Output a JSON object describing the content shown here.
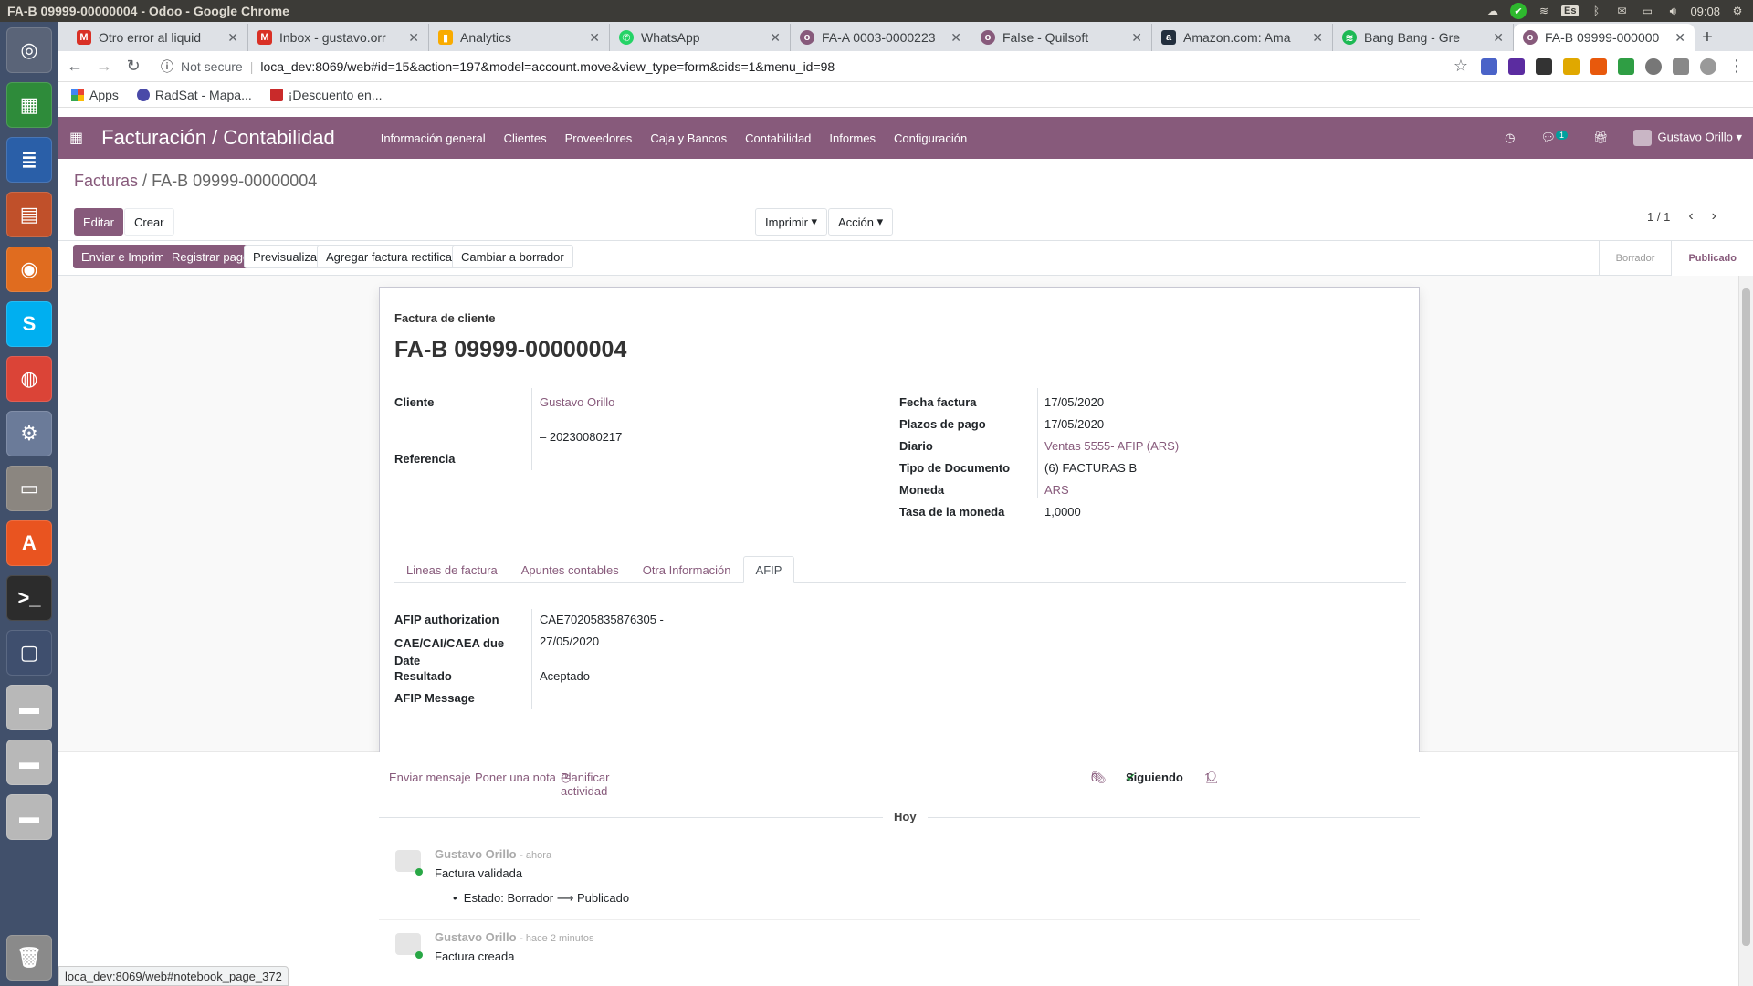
{
  "os": {
    "window_title": "FA-B 09999-00000004 - Odoo - Google Chrome",
    "clock": "09:08",
    "lang": "Es"
  },
  "chrome": {
    "tabs": [
      {
        "title": "Otro error al liquid",
        "favicon": "gmail-icon",
        "color": "#d93025"
      },
      {
        "title": "Inbox - gustavo.orr",
        "favicon": "gmail-icon",
        "color": "#d93025"
      },
      {
        "title": "Analytics",
        "favicon": "analytics-icon",
        "color": "#f9ab00"
      },
      {
        "title": "WhatsApp",
        "favicon": "whatsapp-icon",
        "color": "#25d366"
      },
      {
        "title": "FA-A 0003-0000223",
        "favicon": "odoo-icon",
        "color": "#875a7b"
      },
      {
        "title": "False - Quilsoft",
        "favicon": "odoo-icon",
        "color": "#875a7b"
      },
      {
        "title": "Amazon.com: Ama",
        "favicon": "amazon-icon",
        "color": "#232f3e"
      },
      {
        "title": "Bang Bang - Gre",
        "favicon": "spotify-icon",
        "color": "#1db954"
      },
      {
        "title": "FA-B 09999-000000",
        "favicon": "odoo-icon",
        "color": "#875a7b",
        "active": true
      }
    ],
    "not_secure": "Not secure",
    "url": "loca_dev:8069/web#id=15&action=197&model=account.move&view_type=form&cids=1&menu_id=98",
    "bookmarks": [
      "Apps",
      "RadSat - Mapa...",
      "¡Descuento en..."
    ],
    "status_hint": "loca_dev:8069/web#notebook_page_372"
  },
  "odoo": {
    "app_name": "Facturación / Contabilidad",
    "menu": [
      "Información general",
      "Clientes",
      "Proveedores",
      "Caja y Bancos",
      "Contabilidad",
      "Informes",
      "Configuración"
    ],
    "chat_badge": "1",
    "user": "Gustavo Orillo",
    "breadcrumb_parent": "Facturas",
    "breadcrumb_current": "FA-B 09999-00000004",
    "breadcrumb_sep": "/",
    "btn_edit": "Editar",
    "btn_create": "Crear",
    "btn_print": "Imprimir",
    "btn_action": "Acción",
    "pager": "1 / 1",
    "status_buttons": [
      "Enviar e Imprimir",
      "Registrar pago",
      "Previsualizar",
      "Agregar factura rectificativa",
      "Cambiar a borrador"
    ],
    "states": [
      "Borrador",
      "Publicado"
    ],
    "form": {
      "doc_type": "Factura de cliente",
      "doc_number": "FA-B 09999-00000004",
      "left": {
        "cliente_label": "Cliente",
        "cliente_value": "Gustavo Orillo",
        "cliente_vat": "– 20230080217",
        "referencia_label": "Referencia"
      },
      "right": [
        {
          "label": "Fecha factura",
          "value": "17/05/2020",
          "link": false
        },
        {
          "label": "Plazos de pago",
          "value": "17/05/2020",
          "link": false
        },
        {
          "label": "Diario",
          "value": "Ventas 5555- AFIP (ARS)",
          "link": true
        },
        {
          "label": "Tipo de Documento",
          "value": "(6) FACTURAS B",
          "link": false
        },
        {
          "label": "Moneda",
          "value": "ARS",
          "link": true
        },
        {
          "label": "Tasa de la moneda",
          "value": "1,0000",
          "link": false
        }
      ],
      "tabs": [
        "Lineas de factura",
        "Apuntes contables",
        "Otra Información",
        "AFIP"
      ],
      "active_tab": "AFIP",
      "afip": [
        {
          "label": "AFIP authorization",
          "value": "CAE70205835876305 -"
        },
        {
          "label": "CAE/CAI/CAEA due Date",
          "value": "27/05/2020"
        },
        {
          "label": "Resultado",
          "value": "Aceptado"
        },
        {
          "label": "AFIP Message",
          "value": ""
        }
      ]
    },
    "chatter": {
      "send_message": "Enviar mensaje",
      "log_note": "Poner una nota",
      "schedule": "Planificar actividad",
      "attachments": "0",
      "following": "Siguiendo",
      "followers": "1",
      "day": "Hoy",
      "messages": [
        {
          "author": "Gustavo Orillo",
          "when": "- ahora",
          "body": "Factura validada",
          "tracking_field": "Estado:",
          "tracking_old": "Borrador",
          "tracking_new": "Publicado"
        },
        {
          "author": "Gustavo Orillo",
          "when": "- hace 2 minutos",
          "body": "Factura creada"
        }
      ]
    }
  }
}
